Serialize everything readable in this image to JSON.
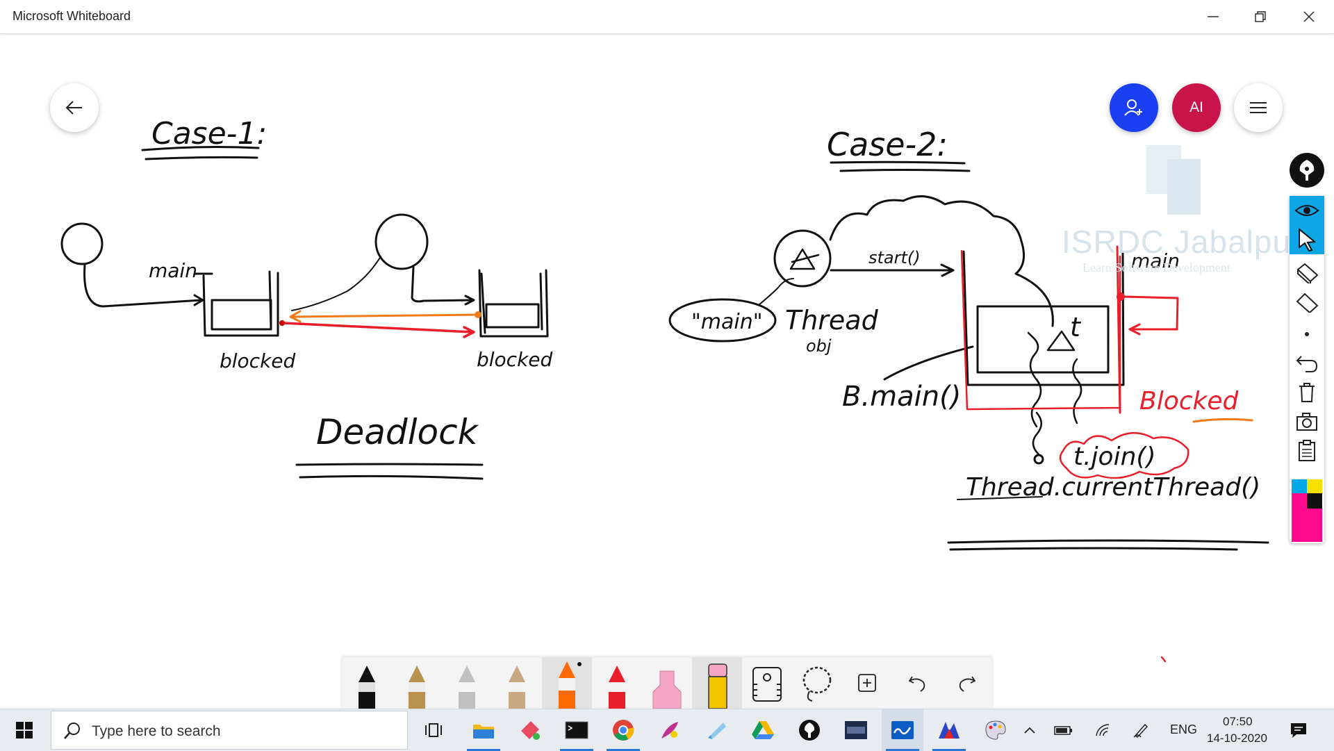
{
  "window": {
    "title": "Microsoft Whiteboard",
    "controls": [
      "minimize-icon",
      "restore-icon",
      "close-icon"
    ]
  },
  "board": {
    "case1": {
      "heading": "Case-1:",
      "thread_label": "main",
      "state_left": "blocked",
      "state_right": "blocked",
      "caption": "Deadlock"
    },
    "case2": {
      "heading": "Case-2:",
      "start_label": "start()",
      "main_label": "\"main\"",
      "thread_label_line1": "Thread",
      "thread_label_line2": "obj",
      "main_stack": "main",
      "blocked_label": "Blocked",
      "t_label": "t",
      "bmain_label": "B.main()",
      "join_label": "t.join()",
      "current_thread_label": "Thread.currentThread()"
    }
  },
  "top_controls": {
    "back": "arrow-left-icon",
    "invite": "add-person-icon",
    "avatar_initials": "AI",
    "menu": "hamburger-icon"
  },
  "watermark": {
    "title": "ISRDC Jabalpur",
    "subtitle": "Learn Software Development"
  },
  "side_toolbar": {
    "items": [
      "pen-icon",
      "eye-icon",
      "pointer-icon",
      "ruler-icon",
      "eraser-icon",
      "dot-icon",
      "undo-icon",
      "trash-icon",
      "camera-icon",
      "clipboard-icon"
    ],
    "active": [
      "eye-icon",
      "pointer-icon"
    ],
    "palette_colors": [
      "#00a8e8",
      "#f6e200",
      "#ff0a8c",
      "#111111"
    ]
  },
  "ink_toolbar": {
    "tools": [
      {
        "name": "black-pen",
        "color": "#111111"
      },
      {
        "name": "gold-pen",
        "color": "#b9924f"
      },
      {
        "name": "silver-pen",
        "color": "#c0c0c0"
      },
      {
        "name": "bronze-pen",
        "color": "#c8a882"
      },
      {
        "name": "orange-pen",
        "color": "#ff6a00"
      },
      {
        "name": "red-pen",
        "color": "#e81e2a"
      },
      {
        "name": "pink-highlighter",
        "color": "#f4a6c4"
      },
      {
        "name": "yellow-pencil",
        "color": "#f5c400"
      }
    ],
    "selected": "orange-pen",
    "actions": [
      "ruler-tool-icon",
      "lasso-icon",
      "add-icon",
      "undo-icon",
      "redo-icon"
    ]
  },
  "taskbar": {
    "search_placeholder": "Type here to search",
    "apps": [
      "task-view-icon",
      "file-explorer-icon",
      "paint-icon",
      "terminal-icon",
      "chrome-icon",
      "feather-icon",
      "notes-icon",
      "drive-icon",
      "pen-app-icon",
      "mysql-icon",
      "whiteboard-icon",
      "color-app-icon",
      "palette-icon"
    ],
    "running": [
      "file-explorer-icon",
      "terminal-icon",
      "chrome-icon",
      "whiteboard-icon",
      "color-app-icon"
    ],
    "language": "ENG",
    "time": "07:50",
    "date": "14-10-2020"
  }
}
